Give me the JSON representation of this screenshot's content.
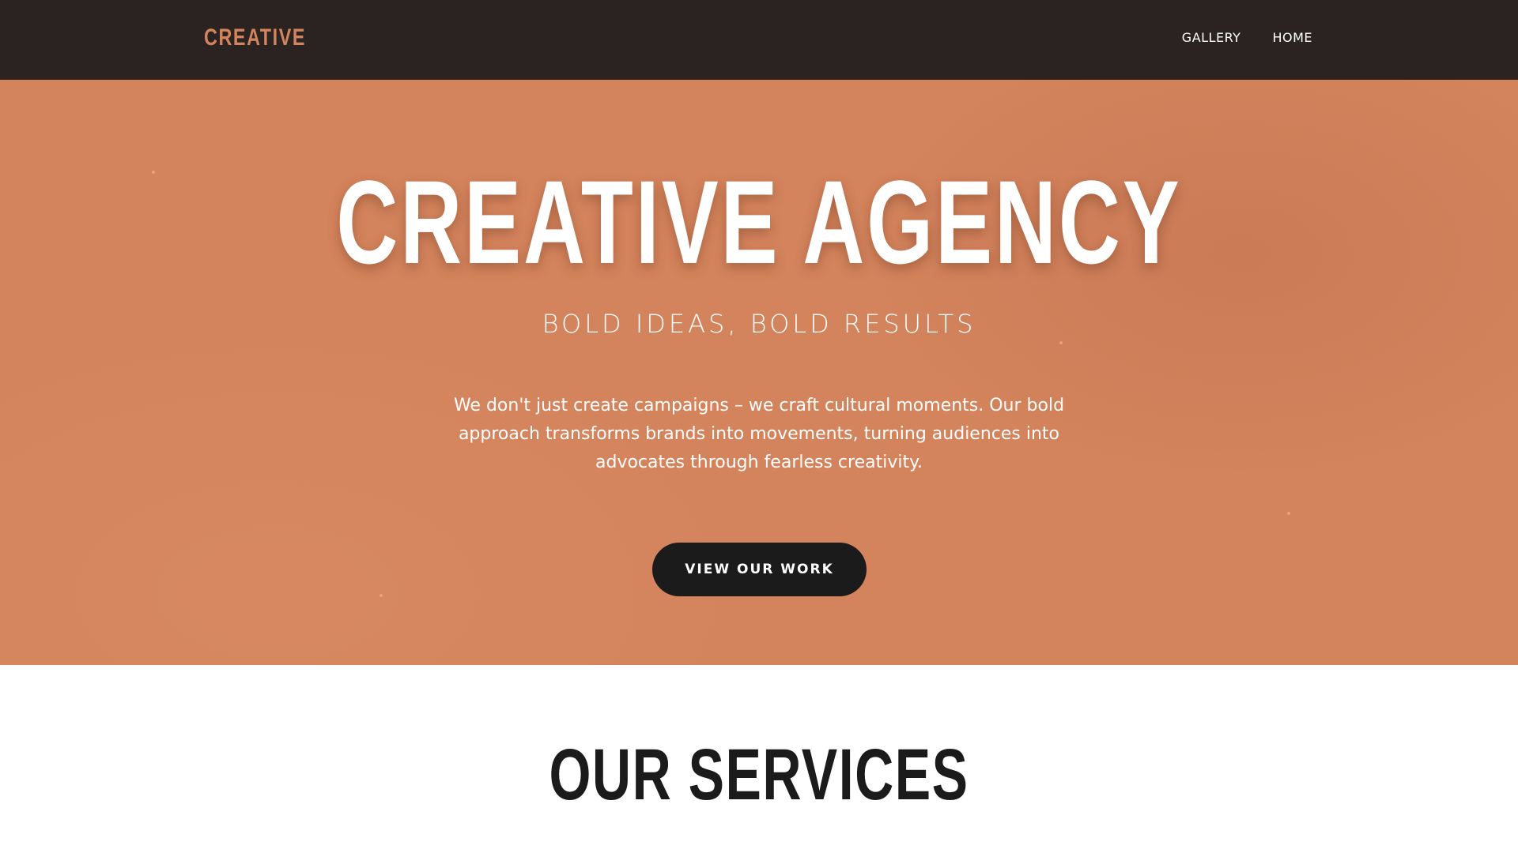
{
  "header": {
    "logo": "CREATIVE",
    "nav": [
      {
        "label": "GALLERY"
      },
      {
        "label": "HOME"
      }
    ]
  },
  "hero": {
    "title": "CREATIVE AGENCY",
    "subtitle": "BOLD IDEAS, BOLD RESULTS",
    "description": "We don't just create campaigns – we craft cultural moments. Our bold approach transforms brands into movements, turning audiences into advocates through fearless creativity.",
    "cta_label": "VIEW OUR WORK"
  },
  "services": {
    "title": "OUR SERVICES"
  },
  "colors": {
    "nav_background": "#2b2321",
    "accent": "#d4845c",
    "button": "#1b1b1b",
    "text_dark": "#1b1b1b"
  }
}
